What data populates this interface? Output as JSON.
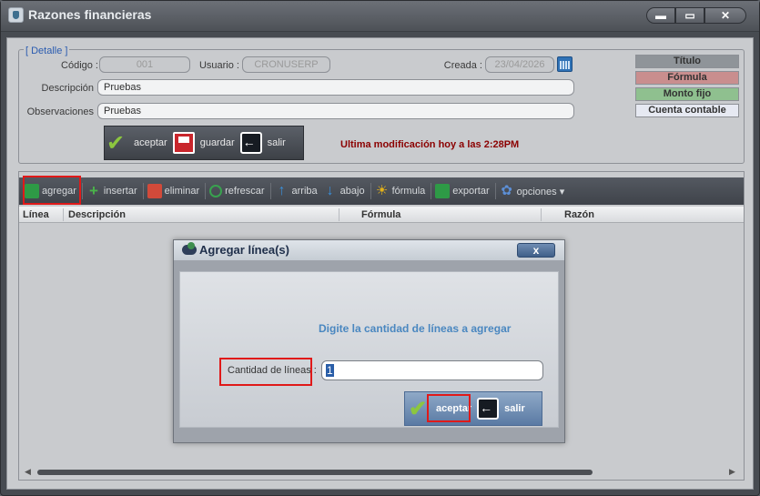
{
  "window": {
    "title": "Razones financieras",
    "controls": [
      "▬",
      "▭",
      "✕"
    ]
  },
  "detail": {
    "legend": "[ Detalle ]",
    "codigo_label": "Código :",
    "codigo_value": "001",
    "usuario_label": "Usuario :",
    "usuario_value": "CRONUSERP",
    "creada_label": "Creada :",
    "creada_value": "23/04/2026",
    "descripcion_label": "Descripción",
    "descripcion_value": "Pruebas",
    "observaciones_label": "Observaciones",
    "observaciones_value": "Pruebas",
    "last_modified": "Ultima modificación hoy a las   2:28PM"
  },
  "actions": {
    "accept": "aceptar",
    "save": "guardar",
    "exit": "salir"
  },
  "legend_items": [
    {
      "label": "Título",
      "color": "#8f9499"
    },
    {
      "label": "Fórmula",
      "color": "#c98e8e"
    },
    {
      "label": "Monto fijo",
      "color": "#8fc08f"
    },
    {
      "label": "Cuenta contable",
      "color": "#e6e9f2"
    }
  ],
  "toolbar": {
    "add": "agregar",
    "insert": "insertar",
    "delete": "eliminar",
    "refresh": "refrescar",
    "up": "arriba",
    "down": "abajo",
    "formula": "fórmula",
    "export": "exportar",
    "options": "opciones ▾"
  },
  "grid": {
    "columns": [
      "Línea",
      "Descripción",
      "Fórmula",
      "Razón"
    ]
  },
  "dialog": {
    "title": "Agregar línea(s)",
    "close": "x",
    "message": "Digite la cantidad de líneas a agregar",
    "qty_label": "Cantidad de líneas :",
    "qty_value": "1",
    "accept": "aceptar",
    "exit": "salir"
  }
}
